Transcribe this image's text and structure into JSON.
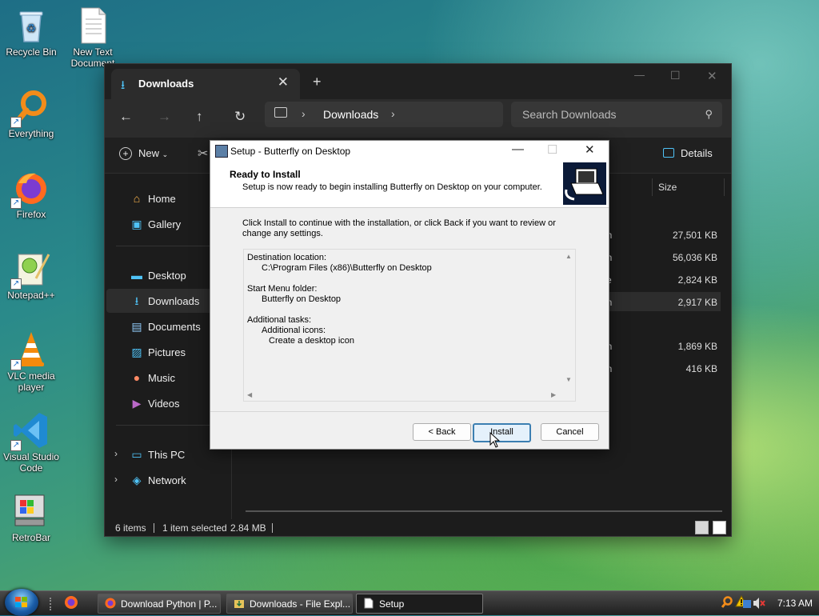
{
  "desktop": {
    "icons": [
      {
        "label": "Recycle Bin",
        "icon": "recycle-bin-icon"
      },
      {
        "label": "New Text Document",
        "icon": "text-document-icon"
      },
      {
        "label": "Everything",
        "icon": "everything-search-icon"
      },
      {
        "label": "Firefox",
        "icon": "firefox-icon"
      },
      {
        "label": "Notepad++",
        "icon": "notepad-plus-plus-icon"
      },
      {
        "label": "VLC media player",
        "icon": "vlc-icon"
      },
      {
        "label": "Visual Studio Code",
        "icon": "vscode-icon"
      },
      {
        "label": "RetroBar",
        "icon": "retrobar-icon"
      }
    ]
  },
  "explorer": {
    "tab_title": "Downloads",
    "new_tab": "+",
    "breadcrumb": "Downloads",
    "search_placeholder": "Search Downloads",
    "new_label": "New",
    "details_label": "Details",
    "sidebar": [
      {
        "label": "Home",
        "icon": "home-icon"
      },
      {
        "label": "Gallery",
        "icon": "gallery-icon"
      },
      {
        "label": "Desktop",
        "icon": "desktop-icon"
      },
      {
        "label": "Downloads",
        "icon": "downloads-icon",
        "selected": true
      },
      {
        "label": "Documents",
        "icon": "documents-icon"
      },
      {
        "label": "Pictures",
        "icon": "pictures-icon"
      },
      {
        "label": "Music",
        "icon": "music-icon"
      },
      {
        "label": "Videos",
        "icon": "videos-icon"
      },
      {
        "label": "This PC",
        "icon": "this-pc-icon"
      },
      {
        "label": "Network",
        "icon": "network-icon"
      }
    ],
    "columns": {
      "size": "Size"
    },
    "rows": [
      {
        "type": "on",
        "size": "27,501 KB"
      },
      {
        "type": "on",
        "size": "56,036 KB"
      },
      {
        "type": "ve",
        "size": "2,824 KB"
      },
      {
        "type": "on",
        "size": "2,917 KB",
        "selected": true
      },
      {
        "type": "on",
        "size": "1,869 KB"
      },
      {
        "type": "on",
        "size": "416 KB"
      }
    ],
    "status": {
      "items": "6 items",
      "selected": "1 item selected",
      "size": "2.84 MB"
    }
  },
  "setup": {
    "title": "Setup - Butterfly on Desktop",
    "header_title": "Ready to Install",
    "header_subtitle": "Setup is now ready to begin installing Butterfly on Desktop on your computer.",
    "body_line1": "Click Install to continue with the installation, or click Back if you want to review or",
    "body_line2": "change any settings.",
    "memo": [
      "Destination location:",
      "C:\\Program Files (x86)\\Butterfly on Desktop",
      "Start Menu folder:",
      "Butterfly on Desktop",
      "Additional tasks:",
      "Additional icons:",
      "Create a desktop icon"
    ],
    "buttons": {
      "back": "< Back",
      "install": "Install",
      "cancel": "Cancel"
    }
  },
  "taskbar": {
    "items": [
      {
        "label": "Download Python | P...",
        "icon": "firefox-icon"
      },
      {
        "label": "Downloads - File Expl...",
        "icon": "folder-downloads-icon"
      },
      {
        "label": "Setup",
        "icon": "setup-icon",
        "active": true
      }
    ],
    "clock": "7:13 AM"
  }
}
